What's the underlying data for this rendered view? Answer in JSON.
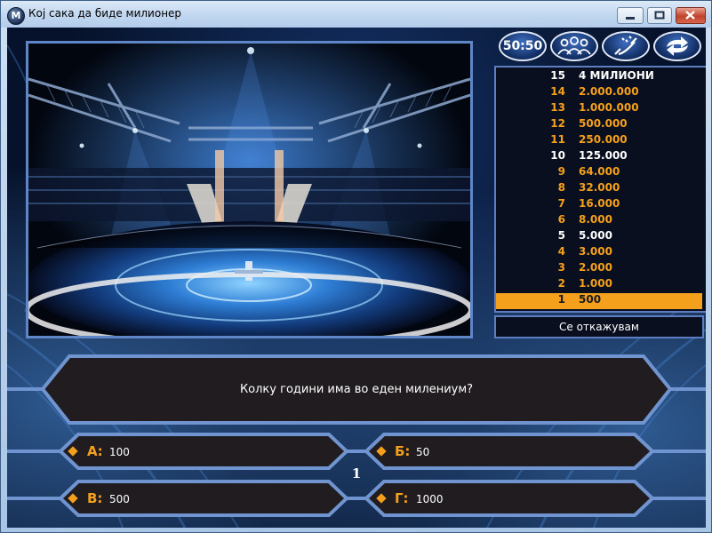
{
  "window": {
    "title": "Кој сака да биде милионер",
    "icon": "M"
  },
  "lifelines": [
    {
      "name": "fifty-fifty",
      "label": "50:50"
    },
    {
      "name": "ask-audience",
      "icon": "audience-icon"
    },
    {
      "name": "phone-friend",
      "icon": "phone-icon"
    },
    {
      "name": "switch-question",
      "icon": "swap-arrows-icon"
    }
  ],
  "ladder": [
    {
      "n": "15",
      "v": "4 МИЛИОНИ",
      "safe": true
    },
    {
      "n": "14",
      "v": "2.000.000"
    },
    {
      "n": "13",
      "v": "1.000.000"
    },
    {
      "n": "12",
      "v": "500.000"
    },
    {
      "n": "11",
      "v": "250.000"
    },
    {
      "n": "10",
      "v": "125.000",
      "safe": true
    },
    {
      "n": "9",
      "v": "64.000"
    },
    {
      "n": "8",
      "v": "32.000"
    },
    {
      "n": "7",
      "v": "16.000"
    },
    {
      "n": "6",
      "v": "8.000"
    },
    {
      "n": "5",
      "v": "5.000",
      "safe": true
    },
    {
      "n": "4",
      "v": "3.000"
    },
    {
      "n": "3",
      "v": "2.000"
    },
    {
      "n": "2",
      "v": "1.000"
    },
    {
      "n": "1",
      "v": "500",
      "current": true
    }
  ],
  "quit_label": "Се откажувам",
  "question": "Колку години има во еден милениум?",
  "answers": [
    {
      "label": "А:",
      "text": "100"
    },
    {
      "label": "Б:",
      "text": "50"
    },
    {
      "label": "В:",
      "text": "500"
    },
    {
      "label": "Г:",
      "text": "1000"
    }
  ],
  "question_number": "1",
  "colors": {
    "accent": "#f5a01c",
    "frame": "#5f86c6",
    "panel": "#211c1f"
  }
}
